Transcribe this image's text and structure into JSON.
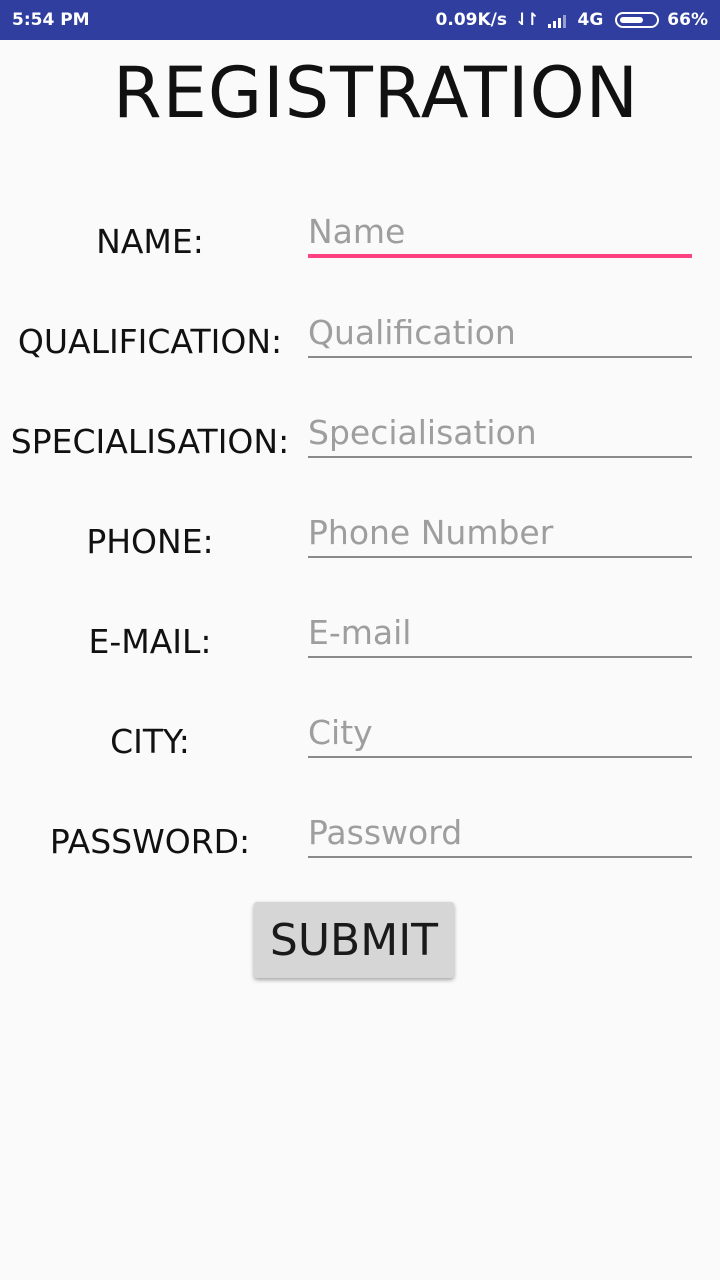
{
  "status_bar": {
    "time": "5:54 PM",
    "net_speed": "0.09K/s",
    "network": "4G",
    "battery": "66%",
    "battery_level": 0.66,
    "color": "#303f9f"
  },
  "page": {
    "title": "REGISTRATION"
  },
  "form": {
    "fields": [
      {
        "label": "NAME:",
        "placeholder": "Name",
        "value": ""
      },
      {
        "label": "QUALIFICATION:",
        "placeholder": "Qualification",
        "value": ""
      },
      {
        "label": "SPECIALISATION:",
        "placeholder": "Specialisation",
        "value": ""
      },
      {
        "label": "PHONE:",
        "placeholder": "Phone Number",
        "value": ""
      },
      {
        "label": "E-MAIL:",
        "placeholder": "E-mail",
        "value": ""
      },
      {
        "label": "CITY:",
        "placeholder": "City",
        "value": ""
      },
      {
        "label": "PASSWORD:",
        "placeholder": "Password",
        "value": ""
      }
    ],
    "focused_field": "Name",
    "accent_color": "#ff4081",
    "submit_label": "SUBMIT"
  },
  "icons": {
    "data_transfer": "data-arrows-icon",
    "signal": "signal-icon",
    "battery": "battery-icon"
  }
}
